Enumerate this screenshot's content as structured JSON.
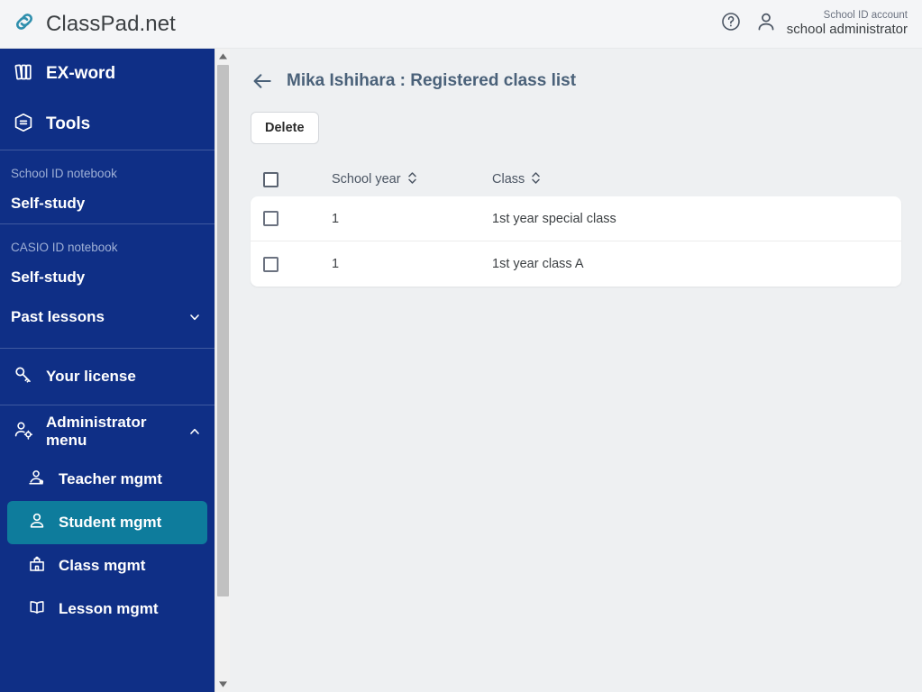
{
  "app": {
    "brand": "ClassPad.net",
    "logo_icon": "chain-link-icon",
    "brand_color": "#2f8fad",
    "sidebar_color": "#0f2f86",
    "accent_color": "#0e7c9c"
  },
  "topbar": {
    "help_icon": "help-circle-icon",
    "user_icon": "user-icon",
    "account_kind": "School ID account",
    "account_name": "school administrator"
  },
  "sidebar": {
    "top_items": [
      {
        "label": "EX-word",
        "icon": "books-icon"
      },
      {
        "label": "Tools",
        "icon": "toolbox-icon"
      }
    ],
    "groups": [
      {
        "title": "School ID notebook",
        "items": [
          {
            "label": "Self-study",
            "expandable": false
          }
        ]
      },
      {
        "title": "CASIO ID notebook",
        "items": [
          {
            "label": "Self-study",
            "expandable": false
          },
          {
            "label": "Past lessons",
            "expandable": true,
            "expanded": false
          }
        ]
      }
    ],
    "license": {
      "label": "Your license",
      "icon": "key-icon"
    },
    "admin": {
      "label": "Administrator menu",
      "icon": "user-gear-icon",
      "expanded": true,
      "items": [
        {
          "label": "Teacher mgmt",
          "icon": "teacher-icon",
          "active": false
        },
        {
          "label": "Student mgmt",
          "icon": "student-icon",
          "active": true
        },
        {
          "label": "Class mgmt",
          "icon": "school-building-icon",
          "active": false
        },
        {
          "label": "Lesson mgmt",
          "icon": "open-book-icon",
          "active": false
        }
      ]
    },
    "scrollbar": {
      "up_arrow": "caret-up-icon",
      "down_arrow": "caret-down-icon"
    }
  },
  "main": {
    "back_icon": "arrow-left-icon",
    "title": "Mika Ishihara : Registered class list",
    "delete_label": "Delete",
    "table": {
      "sort_icon": "sort-updown-icon",
      "columns": [
        {
          "key": "select",
          "label": ""
        },
        {
          "key": "school_year",
          "label": "School year",
          "sortable": true
        },
        {
          "key": "class",
          "label": "Class",
          "sortable": true
        }
      ],
      "rows": [
        {
          "selected": false,
          "school_year": "1",
          "class": "1st year special class"
        },
        {
          "selected": false,
          "school_year": "1",
          "class": "1st year class A"
        }
      ]
    }
  }
}
